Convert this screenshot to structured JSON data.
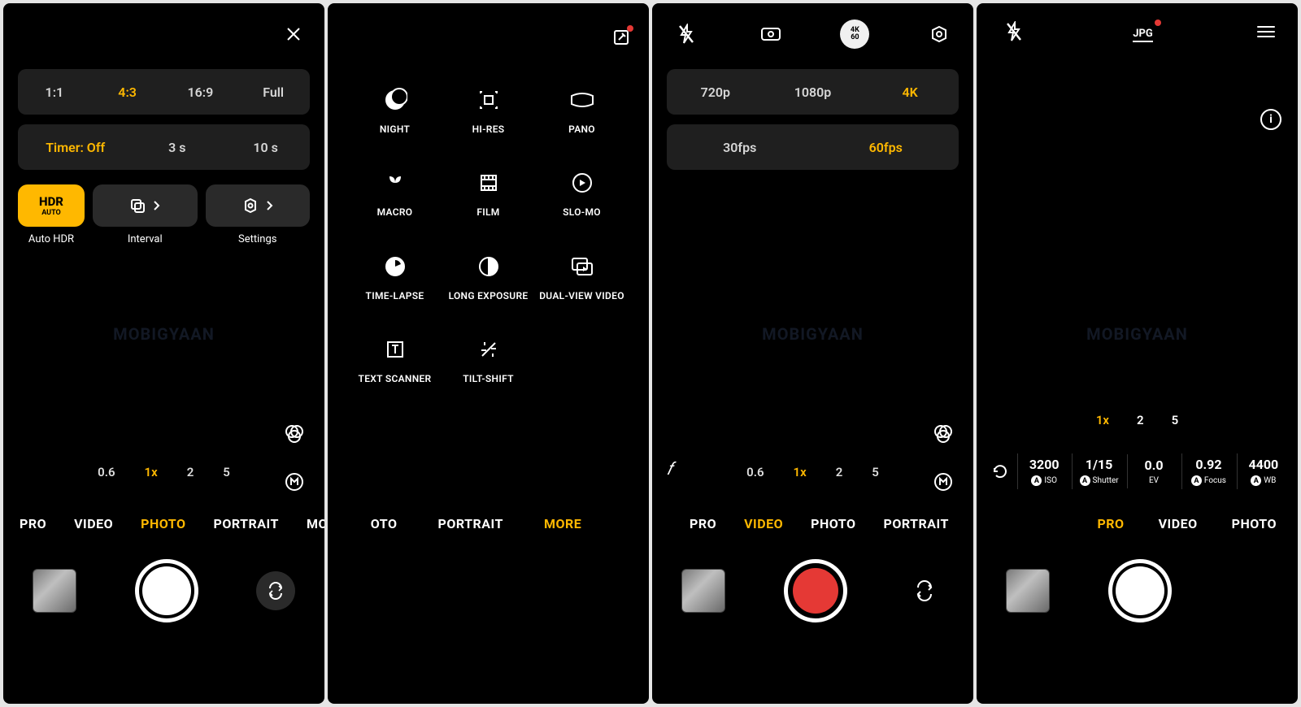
{
  "watermark": "MOBIGYAAN",
  "screen1": {
    "aspect": {
      "items": [
        "1:1",
        "4:3",
        "16:9",
        "Full"
      ],
      "active": 1
    },
    "timer": {
      "items": [
        "Timer: Off",
        "3 s",
        "10 s"
      ],
      "active": 0
    },
    "hdr_main": "HDR",
    "hdr_sub": "AUTO",
    "labels": {
      "hdr": "Auto HDR",
      "interval": "Interval",
      "settings": "Settings"
    },
    "zoom": {
      "items": [
        "0.6",
        "1x",
        "2",
        "5"
      ],
      "active": 1
    },
    "modes": [
      "PRO",
      "VIDEO",
      "PHOTO",
      "PORTRAIT",
      "MORE"
    ],
    "active_mode": 2
  },
  "screen2": {
    "modes_grid": [
      "NIGHT",
      "HI-RES",
      "PANO",
      "MACRO",
      "FILM",
      "SLO-MO",
      "TIME-LAPSE",
      "LONG EXPOSURE",
      "DUAL-VIEW VIDEO",
      "TEXT SCANNER",
      "TILT-SHIFT"
    ],
    "bottom_modes": [
      "OTO",
      "PORTRAIT",
      "MORE"
    ],
    "active_mode": 2
  },
  "screen3": {
    "res": {
      "items": [
        "720p",
        "1080p",
        "4K"
      ],
      "active": 2
    },
    "fps": {
      "items": [
        "30fps",
        "60fps"
      ],
      "active": 1
    },
    "badge_top": "4K",
    "badge_bottom": "60",
    "zoom": {
      "items": [
        "0.6",
        "1x",
        "2",
        "5"
      ],
      "active": 1
    },
    "modes": [
      "PRO",
      "VIDEO",
      "PHOTO",
      "PORTRAIT"
    ],
    "active_mode": 1
  },
  "screen4": {
    "jpg": "JPG",
    "zoom": {
      "items": [
        "1x",
        "2",
        "5"
      ],
      "active": 0
    },
    "params": [
      {
        "val": "3200",
        "lab": "ISO",
        "auto": true
      },
      {
        "val": "1/15",
        "lab": "Shutter",
        "auto": true
      },
      {
        "val": "0.0",
        "lab": "EV",
        "auto": false
      },
      {
        "val": "0.92",
        "lab": "Focus",
        "auto": true
      },
      {
        "val": "4400",
        "lab": "WB",
        "auto": true
      }
    ],
    "modes": [
      "PRO",
      "VIDEO",
      "PHOTO"
    ],
    "active_mode": 0
  }
}
